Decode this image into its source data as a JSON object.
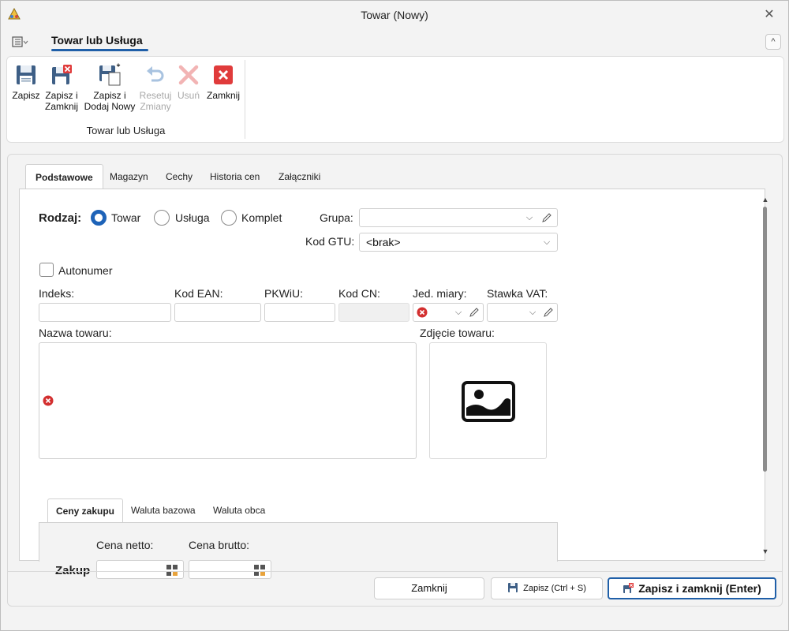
{
  "window": {
    "title": "Towar (Nowy)",
    "close_symbol": "✕"
  },
  "ribbon": {
    "tab_label": "Towar lub Usługa",
    "collapse_symbol": "^",
    "buttons": [
      {
        "label_line1": "Zapisz",
        "label_line2": "",
        "icon": "save-icon",
        "enabled": true
      },
      {
        "label_line1": "Zapisz i",
        "label_line2": "Zamknij",
        "icon": "save-close-icon",
        "enabled": true
      },
      {
        "label_line1": "Zapisz i",
        "label_line2": "Dodaj Nowy",
        "icon": "save-add-new-icon",
        "enabled": true
      },
      {
        "label_line1": "Resetuj",
        "label_line2": "Zmiany",
        "icon": "undo-icon",
        "enabled": false
      },
      {
        "label_line1": "Usuń",
        "label_line2": "",
        "icon": "delete-icon",
        "enabled": false
      },
      {
        "label_line1": "Zamknij",
        "label_line2": "",
        "icon": "close-red-icon",
        "enabled": true
      }
    ],
    "group_label": "Towar lub Usługa"
  },
  "tabs": [
    {
      "label": "Podstawowe",
      "active": true
    },
    {
      "label": "Magazyn",
      "active": false
    },
    {
      "label": "Cechy",
      "active": false
    },
    {
      "label": "Historia cen",
      "active": false
    },
    {
      "label": "Załączniki",
      "active": false
    }
  ],
  "form": {
    "type_label": "Rodzaj:",
    "type_options": [
      {
        "label": "Towar",
        "selected": true
      },
      {
        "label": "Usługa",
        "selected": false
      },
      {
        "label": "Komplet",
        "selected": false
      }
    ],
    "group_label": "Grupa:",
    "group_value": "",
    "gtu_label": "Kod GTU:",
    "gtu_value": "<brak>",
    "autonumber_label": "Autonumer",
    "autonumber_checked": false,
    "index_label": "Indeks:",
    "ean_label": "Kod EAN:",
    "pkwiu_label": "PKWiU:",
    "cn_label": "Kod CN:",
    "unit_label": "Jed. miary:",
    "vat_label": "Stawka VAT:",
    "name_label": "Nazwa towaru:",
    "photo_label": "Zdjęcie towaru:"
  },
  "prices": {
    "subtabs": [
      {
        "label": "Ceny zakupu",
        "active": true
      },
      {
        "label": "Waluta bazowa",
        "active": false
      },
      {
        "label": "Waluta obca",
        "active": false
      }
    ],
    "net_label": "Cena netto:",
    "gross_label": "Cena brutto:",
    "row_label": "Zakup"
  },
  "footer": {
    "close_label": "Zamknij",
    "save_label": "Zapisz (Ctrl + S)",
    "save_close_label": "Zapisz i zamknij (Enter)"
  },
  "colors": {
    "accent": "#1f5fa8",
    "error": "#d32f2f",
    "close_red": "#e03b3b"
  }
}
